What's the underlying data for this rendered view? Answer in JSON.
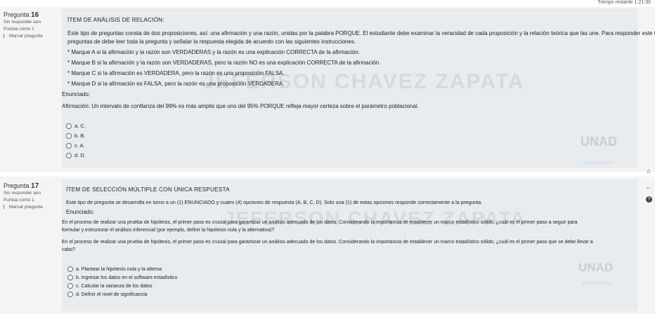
{
  "timer": {
    "label": "Tiempo restante 1:21:30"
  },
  "questions": [
    {
      "number_label": "Pregunta",
      "number": "16",
      "status": "Sin responder aún",
      "points": "Puntúa como 1",
      "flag": "Marcar pregunta",
      "title": "ÍTEM DE ANÁLISIS DE RELACIÓN:",
      "lines": [
        "Este tipo de preguntas consta de dos proposiciones, así: una afirmación y una razón, unidas por la palabra PORQUE. El estudiante debe examinar la veracidad de cada proposición y la relación teórica que las une. Para responder este tipo de",
        "preguntas de debe leer toda la pregunta y señalar la respuesta elegida de acuerdo con las siguientes instrucciones.",
        "* Marque A si la afirmación y la razón son VERDADERAS y la razón es una explicación CORRECTA de la afirmación.",
        "* Marque B si la afirmación y la razón son VERDADERAS, pero la razón NO es una explicación CORRECTA de la afirmación.",
        "* Marque C si la afirmación es VERDADERA, pero la razón es una proposición FALSA.",
        "* Marque D si la afirmación es FALSA, pero la razón es una proposición VERDADERA.",
        "Enunciado:",
        "Afirmación: Un intervalo de confianza del 99% es más amplio que uno del 95% PORQUE refleja mayor certeza sobre el parámetro poblacional."
      ],
      "options": [
        {
          "letter": "a.",
          "text": "C."
        },
        {
          "letter": "b.",
          "text": "B."
        },
        {
          "letter": "c.",
          "text": "A."
        },
        {
          "letter": "d.",
          "text": "D."
        }
      ],
      "watermark": "JEFERSON CHAVEZ ZAPATA"
    },
    {
      "number_label": "Pregunta",
      "number": "17",
      "status": "Sin responder aún",
      "points": "Puntúa como 1",
      "flag": "Marcar pregunta",
      "title": "ÍTEM DE SELECCIÓN MÚLTIPLE CON ÚNICA RESPUESTA",
      "lines": [
        "Este tipo de pregunta se desarrolla en torno a un (1) ENUNCIADO y cuatro (4) opciones de respuesta (A, B, C, D). Solo una (1) de estas opciones responde correctamente a la pregunta.",
        "Enunciado:",
        "En el proceso de realizar una prueba de hipótesis, el primer paso es crucial para garantizar un análisis adecuado de los datos. Considerando la importancia de establecer un marco estadístico sólido, ¿cuál es el primer paso a seguir para",
        "formular y estructurar el análisis inferencial (por ejemplo, definir la hipótesis nula y la alternativa)?",
        "En el proceso de realizar una prueba de hipótesis, el primer paso es crucial para garantizar un análisis adecuado de los datos. Considerando la importancia de establecer un marco estadístico sólido, ¿cuál es el primer paso que se debe llevar a",
        "cabo?"
      ],
      "options": [
        {
          "letter": "a.",
          "text": "Plantear la hipótesis nula y la alterna"
        },
        {
          "letter": "b.",
          "text": "Ingresar los datos en el software estadístico"
        },
        {
          "letter": "c.",
          "text": "Calcular la varianza de los datos"
        },
        {
          "letter": "d.",
          "text": "Definir el nivel de significancia"
        }
      ],
      "watermark": "JEFERSON CHAVEZ ZAPATA"
    }
  ],
  "logo": {
    "text": "UNAD",
    "sub": "ACREDITADA"
  }
}
